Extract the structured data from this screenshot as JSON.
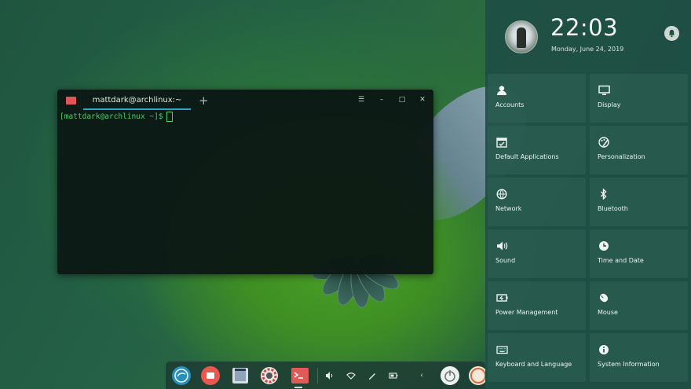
{
  "terminal": {
    "tab_title": "mattdark@archlinux:~",
    "add_tab": "+",
    "menu": "☰",
    "minimize": "–",
    "maximize": "□",
    "close": "✕",
    "prompt": "[mattdark@archlinux ~]$"
  },
  "control_center": {
    "time": "22:03",
    "date": "Monday, June 24, 2019",
    "tiles": [
      {
        "label": "Accounts",
        "icon": "user-icon"
      },
      {
        "label": "Display",
        "icon": "monitor-icon"
      },
      {
        "label": "Default Applications",
        "icon": "default-apps-icon"
      },
      {
        "label": "Personalization",
        "icon": "palette-icon"
      },
      {
        "label": "Network",
        "icon": "network-icon"
      },
      {
        "label": "Bluetooth",
        "icon": "bluetooth-icon"
      },
      {
        "label": "Sound",
        "icon": "speaker-icon"
      },
      {
        "label": "Time and Date",
        "icon": "clock-icon"
      },
      {
        "label": "Power Management",
        "icon": "battery-icon"
      },
      {
        "label": "Mouse",
        "icon": "mouse-icon"
      },
      {
        "label": "Keyboard and Language",
        "icon": "keyboard-icon"
      },
      {
        "label": "System Information",
        "icon": "info-icon"
      }
    ]
  },
  "dock": {
    "tray_chevron": "‹"
  },
  "colors": {
    "accent": "#2fa5c8",
    "terminal_text": "#4ecb6e",
    "panel_bg": "#1e4e44"
  }
}
